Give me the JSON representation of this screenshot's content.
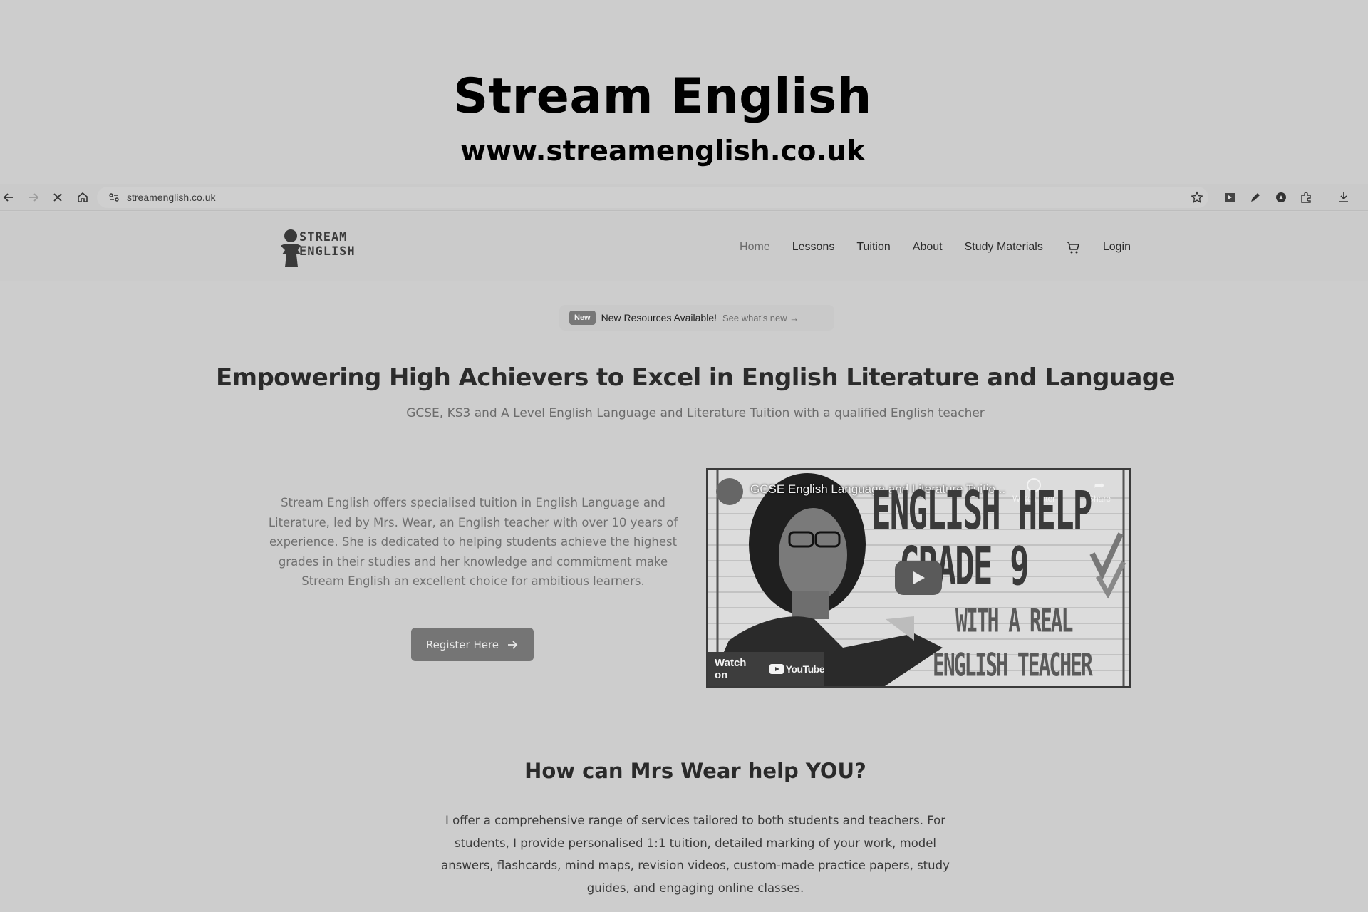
{
  "banner": {
    "title": "Stream English",
    "url": "www.streamenglish.co.uk"
  },
  "browser": {
    "address": "streamenglish.co.uk",
    "icons": [
      "back-arrow-icon",
      "forward-arrow-icon",
      "stop-loading-icon",
      "home-icon",
      "site-info-icon",
      "bookmark-star-icon",
      "extension-icon",
      "pen-icon",
      "profile-icon",
      "puzzle-icon",
      "download-icon"
    ]
  },
  "header": {
    "logo_line1": "STREAM",
    "logo_line2": "ENGLISH",
    "nav": [
      {
        "label": "Home",
        "active": true
      },
      {
        "label": "Lessons"
      },
      {
        "label": "Tuition"
      },
      {
        "label": "About"
      },
      {
        "label": "Study Materials"
      },
      {
        "label": "Login"
      }
    ],
    "cart_icon": "cart-icon"
  },
  "announcement": {
    "badge": "New",
    "text": "New Resources Available!",
    "link": "See what's new →"
  },
  "hero": {
    "title": "Empowering High Achievers to Excel in English Literature and Language",
    "subtitle": "GCSE, KS3 and A Level English Language and Literature Tuition with a qualified English teacher"
  },
  "intro": {
    "text": "Stream English offers specialised tuition in English Language and Literature, led by Mrs. Wear, an English teacher with over 10 years of experience. She is dedicated to helping students achieve the highest grades in their studies and her knowledge and commitment make Stream English an excellent choice for ambitious learners.",
    "button": "Register Here"
  },
  "video": {
    "title": "GCSE English Language and Literature Tuitio...",
    "watch_later": "Watch later",
    "share": "Share",
    "thumb_line1": "ENGLISH HELP",
    "thumb_line2": "GRADE 9",
    "thumb_line3": "WITH A REAL",
    "thumb_line4": "ENGLISH TEACHER",
    "watch_on": "Watch on",
    "yt_brand": "YouTube"
  },
  "help": {
    "title": "How can Mrs Wear help YOU?",
    "body": "I offer a comprehensive range of services tailored to both students and teachers. For students, I provide personalised 1:1 tuition, detailed marking of your work, model answers, flashcards, mind maps, revision videos, custom-made practice papers, study guides, and engaging online classes."
  }
}
